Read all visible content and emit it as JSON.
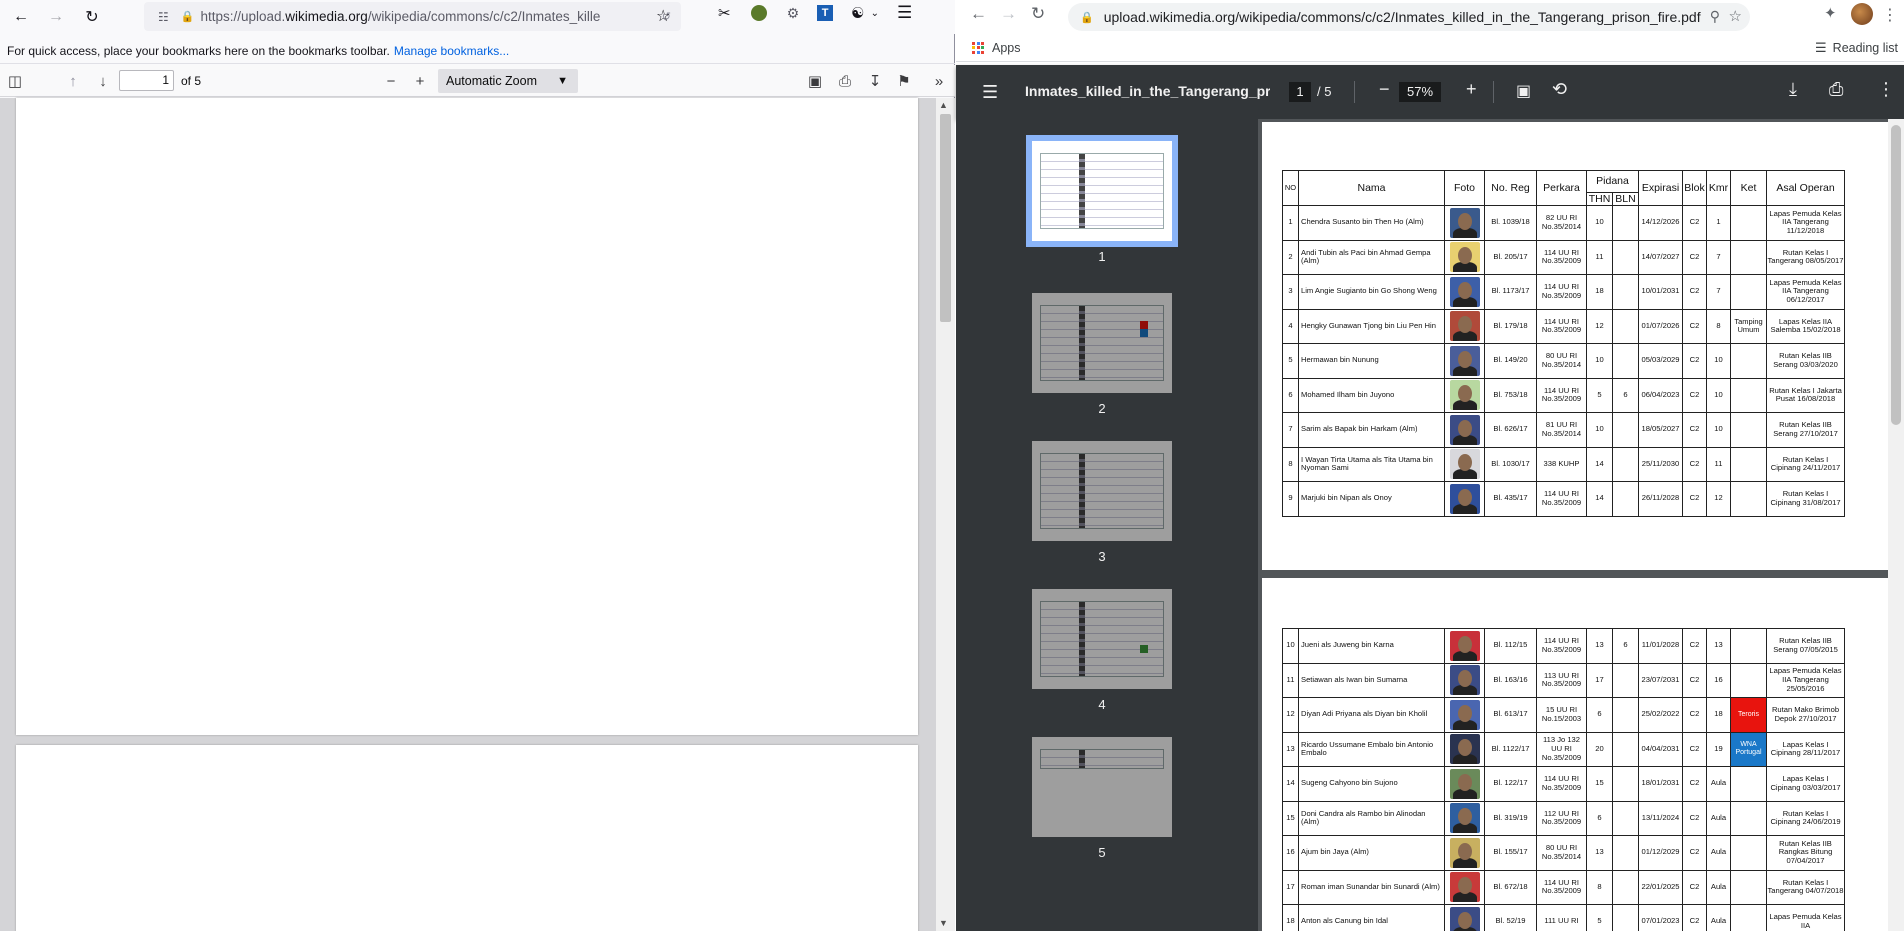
{
  "firefox": {
    "url_prefix": "https://upload.",
    "url_main": "wikimedia.org",
    "url_rest": "/wikipedia/commons/c/c2/Inmates_kille",
    "bookmarks_hint": "For quick access, place your bookmarks here on the bookmarks toolbar.",
    "manage_bookmarks": "Manage bookmarks...",
    "page_number": "1",
    "page_of": "of 5",
    "zoom": "Automatic Zoom"
  },
  "chrome": {
    "url": "upload.wikimedia.org/wikipedia/commons/c/c2/Inmates_killed_in_the_Tangerang_prison_fire.pdf",
    "apps": "Apps",
    "reading_list": "Reading list",
    "pdf_title": "Inmates_killed_in_the_Tangerang_pri...",
    "page_current": "1",
    "page_total": "/ 5",
    "zoom": "57%",
    "thumbnails": [
      "1",
      "2",
      "3",
      "4",
      "5"
    ]
  },
  "table": {
    "headers": {
      "no": "NO",
      "nama": "Nama",
      "foto": "Foto",
      "noreg": "No. Reg",
      "perkara": "Perkara",
      "pidana": "Pidana",
      "thn": "THN",
      "bln": "BLN",
      "expirasi": "Expirasi",
      "blok": "Blok",
      "kmr": "Kmr",
      "ket": "Ket",
      "asal": "Asal Operan"
    },
    "page1_rows": [
      {
        "no": "1",
        "nama": "Chendra Susanto bin Then Ho (Alm)",
        "reg": "Bl. 1039/18",
        "perkara": "82 UU RI No.35/2014",
        "thn": "10",
        "bln": "",
        "exp": "14/12/2026",
        "blok": "C2",
        "kmr": "1",
        "ket": "",
        "asal": "Lapas Pemuda Kelas IIA Tangerang 11/12/2018",
        "bg": "#3a5a8c"
      },
      {
        "no": "2",
        "nama": "Andi Tubin als Paci bin Ahmad Gempa (Alm)",
        "reg": "Bl. 205/17",
        "perkara": "114 UU RI No.35/2009",
        "thn": "11",
        "bln": "",
        "exp": "14/07/2027",
        "blok": "C2",
        "kmr": "7",
        "ket": "",
        "asal": "Rutan Kelas I Tangerang 08/05/2017",
        "bg": "#e8d070"
      },
      {
        "no": "3",
        "nama": "Lim Angie Sugianto bin Go Shong Weng",
        "reg": "Bl. 1173/17",
        "perkara": "114 UU RI No.35/2009",
        "thn": "18",
        "bln": "",
        "exp": "10/01/2031",
        "blok": "C2",
        "kmr": "7",
        "ket": "",
        "asal": "Lapas Pemuda Kelas IIA Tangerang 06/12/2017",
        "bg": "#3d5fa8"
      },
      {
        "no": "4",
        "nama": "Hengky Gunawan Tjong bin Liu Pen Hin",
        "reg": "Bl. 179/18",
        "perkara": "114 UU RI No.35/2009",
        "thn": "12",
        "bln": "",
        "exp": "01/07/2026",
        "blok": "C2",
        "kmr": "8",
        "ket": "Tamping Umum",
        "asal": "Lapas Kelas IIA Salemba 15/02/2018",
        "bg": "#b04a3a"
      },
      {
        "no": "5",
        "nama": "Hermawan bin Nunung",
        "reg": "Bl. 149/20",
        "perkara": "80 UU RI No.35/2014",
        "thn": "10",
        "bln": "",
        "exp": "05/03/2029",
        "blok": "C2",
        "kmr": "10",
        "ket": "",
        "asal": "Rutan Kelas IIB Serang 03/03/2020",
        "bg": "#4a5e9a"
      },
      {
        "no": "6",
        "nama": "Mohamed Ilham bin Juyono",
        "reg": "Bl. 753/18",
        "perkara": "114 UU RI No.35/2009",
        "thn": "5",
        "bln": "6",
        "exp": "06/04/2023",
        "blok": "C2",
        "kmr": "10",
        "ket": "",
        "asal": "Rutan Kelas I Jakarta Pusat 16/08/2018",
        "bg": "#b8d8a0"
      },
      {
        "no": "7",
        "nama": "Sarim als Bapak bin Harkam (Alm)",
        "reg": "Bl. 626/17",
        "perkara": "81 UU RI No.35/2014",
        "thn": "10",
        "bln": "",
        "exp": "18/05/2027",
        "blok": "C2",
        "kmr": "10",
        "ket": "",
        "asal": "Rutan Kelas IIB Serang 27/10/2017",
        "bg": "#3b4c86"
      },
      {
        "no": "8",
        "nama": "I Wayan Tirta Utama als Tita Utama bin Nyoman Sami",
        "reg": "Bl. 1030/17",
        "perkara": "338 KUHP",
        "thn": "14",
        "bln": "",
        "exp": "25/11/2030",
        "blok": "C2",
        "kmr": "11",
        "ket": "",
        "asal": "Rutan Kelas I Cipinang 24/11/2017",
        "bg": "#d8d8dc"
      },
      {
        "no": "9",
        "nama": "Marjuki bin Nipan als Onoy",
        "reg": "Bl. 435/17",
        "perkara": "114 UU RI No.35/2009",
        "thn": "14",
        "bln": "",
        "exp": "26/11/2028",
        "blok": "C2",
        "kmr": "12",
        "ket": "",
        "asal": "Rutan Kelas I Cipinang 31/08/2017",
        "bg": "#2e4f9c"
      }
    ],
    "page2_rows": [
      {
        "no": "10",
        "nama": "Jueni als Juweng bin Karna",
        "reg": "Bl. 112/15",
        "perkara": "114 UU RI No.35/2009",
        "thn": "13",
        "bln": "6",
        "exp": "11/01/2028",
        "blok": "C2",
        "kmr": "13",
        "ket": "",
        "asal": "Rutan Kelas IIB Serang 07/05/2015",
        "bg": "#c8303a"
      },
      {
        "no": "11",
        "nama": "Setiawan als Iwan bin Sumarna",
        "reg": "Bl. 163/16",
        "perkara": "113 UU RI No.35/2009",
        "thn": "17",
        "bln": "",
        "exp": "23/07/2031",
        "blok": "C2",
        "kmr": "16",
        "ket": "",
        "asal": "Lapas Pemuda Kelas IIA Tangerang 25/05/2016",
        "bg": "#3b4c86"
      },
      {
        "no": "12",
        "nama": "Diyan Adi Priyana als Diyan bin Kholil",
        "reg": "Bl. 613/17",
        "perkara": "15 UU RI No.15/2003",
        "thn": "6",
        "bln": "",
        "exp": "25/02/2022",
        "blok": "C2",
        "kmr": "18",
        "ket": "Teroris",
        "asal": "Rutan Mako Brimob Depok 27/10/2017",
        "bg": "#4a66b0",
        "ketbg": "#e8140e"
      },
      {
        "no": "13",
        "nama": "Ricardo Ussumane Embalo bin Antonio Embalo",
        "reg": "Bl. 1122/17",
        "perkara": "113 Jo 132 UU RI No.35/2009",
        "thn": "20",
        "bln": "",
        "exp": "04/04/2031",
        "blok": "C2",
        "kmr": "19",
        "ket": "WNA Portugal",
        "asal": "Lapas Kelas I Cipinang 28/11/2017",
        "bg": "#2a3350",
        "ketbg": "#1a78c8"
      },
      {
        "no": "14",
        "nama": "Sugeng Cahyono bin Sujono",
        "reg": "Bl. 122/17",
        "perkara": "114 UU RI No.35/2009",
        "thn": "15",
        "bln": "",
        "exp": "18/01/2031",
        "blok": "C2",
        "kmr": "Aula",
        "ket": "",
        "asal": "Lapas Kelas I Cipinang 03/03/2017",
        "bg": "#6a8a5a"
      },
      {
        "no": "15",
        "nama": "Doni Candra als Rambo bin Alinodan (Alm)",
        "reg": "Bl. 319/19",
        "perkara": "112 UU RI No.35/2009",
        "thn": "6",
        "bln": "",
        "exp": "13/11/2024",
        "blok": "C2",
        "kmr": "Aula",
        "ket": "",
        "asal": "Rutan Kelas I Cipinang 24/06/2019",
        "bg": "#2e5fa0"
      },
      {
        "no": "16",
        "nama": "Ajum bin Jaya (Alm)",
        "reg": "Bl. 155/17",
        "perkara": "80 UU RI No.35/2014",
        "thn": "13",
        "bln": "",
        "exp": "01/12/2029",
        "blok": "C2",
        "kmr": "Aula",
        "ket": "",
        "asal": "Rutan Kelas IIB Rangkas Bitung 07/04/2017",
        "bg": "#c8b060"
      },
      {
        "no": "17",
        "nama": "Roman iman Sunandar bin Sunardi (Alm)",
        "reg": "Bl. 672/18",
        "perkara": "114 UU RI No.35/2009",
        "thn": "8",
        "bln": "",
        "exp": "22/01/2025",
        "blok": "C2",
        "kmr": "Aula",
        "ket": "",
        "asal": "Rutan Kelas I Tangerang 04/07/2018",
        "bg": "#c83a3a"
      },
      {
        "no": "18",
        "nama": "Anton als Canung bin Idal",
        "reg": "Bl. 52/19",
        "perkara": "111 UU RI",
        "thn": "5",
        "bln": "",
        "exp": "07/01/2023",
        "blok": "C2",
        "kmr": "Aula",
        "ket": "",
        "asal": "Lapas Pemuda Kelas IIA",
        "bg": "#3b4c86"
      }
    ]
  }
}
